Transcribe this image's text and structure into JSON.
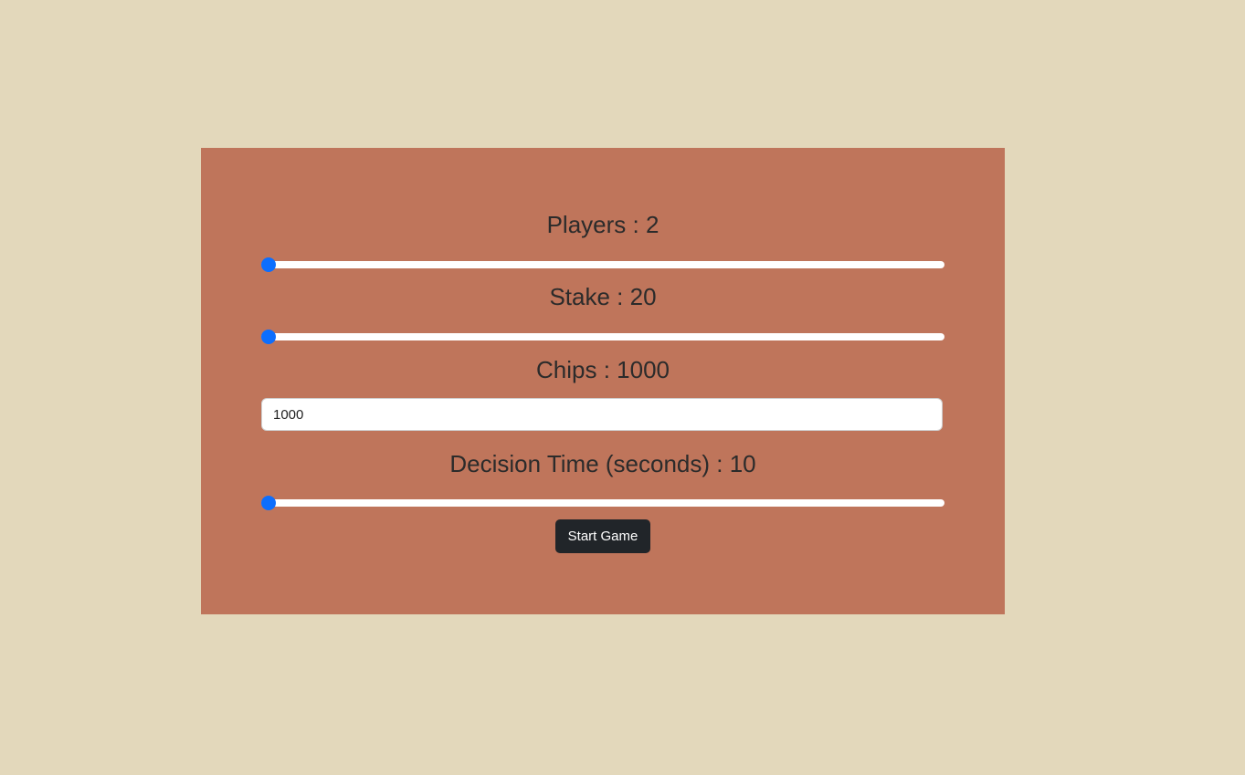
{
  "colors": {
    "page_background": "#e3d8bb",
    "panel_background": "#bf755b",
    "slider_accent": "#0d6efd",
    "button_background": "#212529"
  },
  "settings": {
    "players": {
      "label": "Players : 2",
      "fill_fraction": 0
    },
    "stake": {
      "label": "Stake : 20",
      "fill_fraction": 0
    },
    "chips": {
      "label": "Chips : 1000",
      "input_value": "1000"
    },
    "decision_time": {
      "label": "Decision Time (seconds) : 10",
      "fill_fraction": 0
    }
  },
  "actions": {
    "start_label": "Start Game"
  }
}
